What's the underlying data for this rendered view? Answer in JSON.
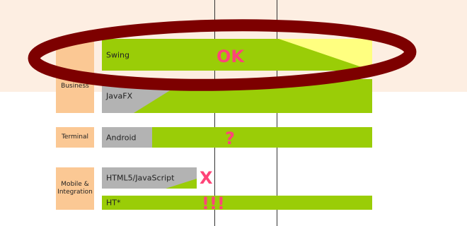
{
  "categories": {
    "business": "Business",
    "terminal": "Terminal",
    "mobile": "Mobile & Integration"
  },
  "bars": {
    "swing": "Swing",
    "javafx": "JavaFX",
    "android": "Android",
    "html5": "HTML5/JavaScript",
    "ht": "HT*"
  },
  "marks": {
    "ok": "OK",
    "question": "?",
    "x": "X",
    "exclaim": "!!!"
  },
  "colors": {
    "bar_green": "#9acd07",
    "bar_gray": "#b3b3b3",
    "bar_yellow": "#ffff80",
    "category_orange": "#fbc894",
    "band_peach": "#fdeee2",
    "mark_pink": "#ff4478",
    "ellipse": "#7d0000"
  }
}
